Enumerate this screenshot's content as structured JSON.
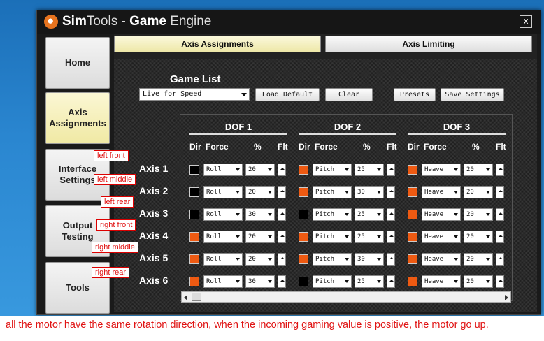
{
  "window": {
    "title_brand": "Sim",
    "title_brand_rest": "Tools",
    "title_sep": " - ",
    "title_bold": "Game",
    "title_rest": " Engine",
    "close_label": "x"
  },
  "sidebar": {
    "items": [
      {
        "label_line1": "Home",
        "label_line2": "",
        "active": false
      },
      {
        "label_line1": "Axis",
        "label_line2": "Assignments",
        "active": true
      },
      {
        "label_line1": "Interface",
        "label_line2": "Settings",
        "active": false
      },
      {
        "label_line1": "Output",
        "label_line2": "Testing",
        "active": false
      },
      {
        "label_line1": "Tools",
        "label_line2": "",
        "active": false
      }
    ]
  },
  "tabs": [
    {
      "label": "Axis Assignments",
      "active": true
    },
    {
      "label": "Axis Limiting",
      "active": false
    }
  ],
  "game_list": {
    "label": "Game List",
    "selected": "Live for Speed",
    "buttons": {
      "load_default": "Load Default",
      "clear": "Clear",
      "presets": "Presets",
      "save_settings": "Save Settings"
    }
  },
  "dofs": [
    "DOF 1",
    "DOF 2",
    "DOF 3"
  ],
  "column_headers": {
    "dir": "Dir",
    "force": "Force",
    "percent": "%",
    "flt": "Flt"
  },
  "axes": [
    {
      "label": "Axis 1",
      "cells": [
        {
          "dir": false,
          "force": "Roll",
          "pct": "20"
        },
        {
          "dir": true,
          "force": "Pitch",
          "pct": "25"
        },
        {
          "dir": true,
          "force": "Heave",
          "pct": "20"
        }
      ]
    },
    {
      "label": "Axis 2",
      "cells": [
        {
          "dir": false,
          "force": "Roll",
          "pct": "20"
        },
        {
          "dir": true,
          "force": "Pitch",
          "pct": "30"
        },
        {
          "dir": true,
          "force": "Heave",
          "pct": "20"
        }
      ]
    },
    {
      "label": "Axis 3",
      "cells": [
        {
          "dir": false,
          "force": "Roll",
          "pct": "30"
        },
        {
          "dir": false,
          "force": "Pitch",
          "pct": "25"
        },
        {
          "dir": true,
          "force": "Heave",
          "pct": "20"
        }
      ]
    },
    {
      "label": "Axis 4",
      "cells": [
        {
          "dir": true,
          "force": "Roll",
          "pct": "20"
        },
        {
          "dir": true,
          "force": "Pitch",
          "pct": "25"
        },
        {
          "dir": true,
          "force": "Heave",
          "pct": "20"
        }
      ]
    },
    {
      "label": "Axis 5",
      "cells": [
        {
          "dir": true,
          "force": "Roll",
          "pct": "20"
        },
        {
          "dir": true,
          "force": "Pitch",
          "pct": "30"
        },
        {
          "dir": true,
          "force": "Heave",
          "pct": "20"
        }
      ]
    },
    {
      "label": "Axis 6",
      "cells": [
        {
          "dir": true,
          "force": "Roll",
          "pct": "30"
        },
        {
          "dir": false,
          "force": "Pitch",
          "pct": "25"
        },
        {
          "dir": true,
          "force": "Heave",
          "pct": "20"
        }
      ]
    }
  ],
  "annotations": [
    "left front",
    "left middle",
    "left rear",
    "right front",
    "right middle",
    "right rear"
  ],
  "caption": "all the motor have the same rotation direction, when the incoming gaming value is positive, the motor go up.",
  "colors": {
    "accent_orange": "#ee5a12",
    "annotation_red": "#e01414"
  }
}
